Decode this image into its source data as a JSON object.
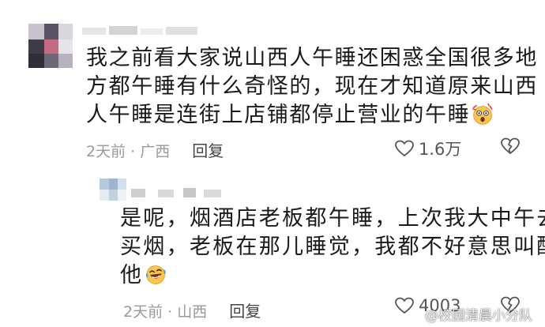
{
  "comment": {
    "lines": [
      "我之前看大家说山西人午睡还困惑全国很多地",
      "方都午睡有什么奇怪的，现在才知道原来山西",
      "人午睡是连街上店铺都停止营业的午睡"
    ],
    "emoji_icon": "shocked-face-emoji",
    "time": "2天前",
    "location": "广西",
    "separator": "·",
    "reply_label": "回复",
    "like_count": "1.6万"
  },
  "reply": {
    "lines": [
      "是呢，烟酒店老板都午睡，上次我大中午去",
      "买烟，老板在那儿睡觉，我都不好意思叫醒",
      "他"
    ],
    "emoji_icon": "laughing-tears-emoji",
    "time": "2天前",
    "location": "山西",
    "separator": "·",
    "reply_label": "回复",
    "like_count": "4003"
  },
  "watermark": "@校园清晨小分队",
  "colors": {
    "text": "#1a1a1a",
    "meta": "#9a9a9a",
    "reply_link": "#444444"
  }
}
